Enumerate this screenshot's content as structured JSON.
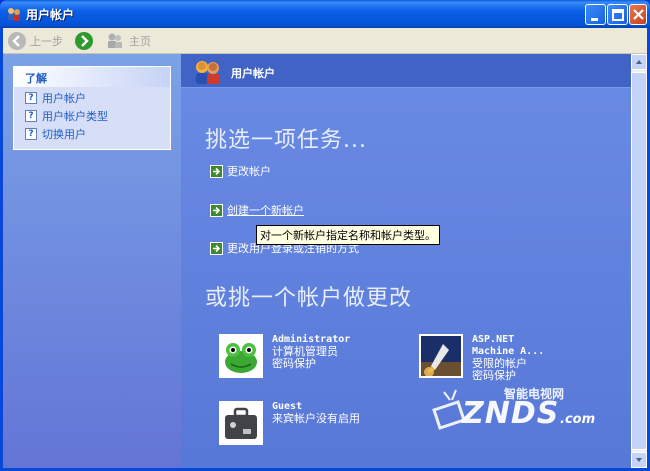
{
  "window": {
    "title": "用户帐户"
  },
  "toolbar": {
    "back_label": "上一步",
    "home_label": "主页"
  },
  "sidebar": {
    "heading": "了解",
    "items": [
      {
        "label": "用户帐户"
      },
      {
        "label": "用户帐户类型"
      },
      {
        "label": "切换用户"
      }
    ]
  },
  "main": {
    "banner_title": "用户帐户",
    "pick_task": "挑选一项任务...",
    "tasks": [
      {
        "label": "更改帐户"
      },
      {
        "label": "创建一个新帐户"
      },
      {
        "label": "更改用户登录或注销的方式"
      }
    ],
    "tooltip": "对一个新帐户指定名称和帐户类型。",
    "pick_account": "或挑一个帐户做更改",
    "accounts": [
      {
        "name": "Administrator",
        "line1": "计算机管理员",
        "line2": "密码保护"
      },
      {
        "name": "ASP.NET Machine A...",
        "line1": "受限的帐户",
        "line2": "密码保护"
      },
      {
        "name": "Guest",
        "line1": "来宾帐户没有启用",
        "line2": ""
      }
    ]
  },
  "watermark": {
    "brand": "ZNDS",
    "cn": "智能电视网",
    "domain": ".com"
  },
  "colors": {
    "accent": "#215dc6",
    "task_bg": "#5a7edc",
    "titlebar": "#0553d6"
  }
}
